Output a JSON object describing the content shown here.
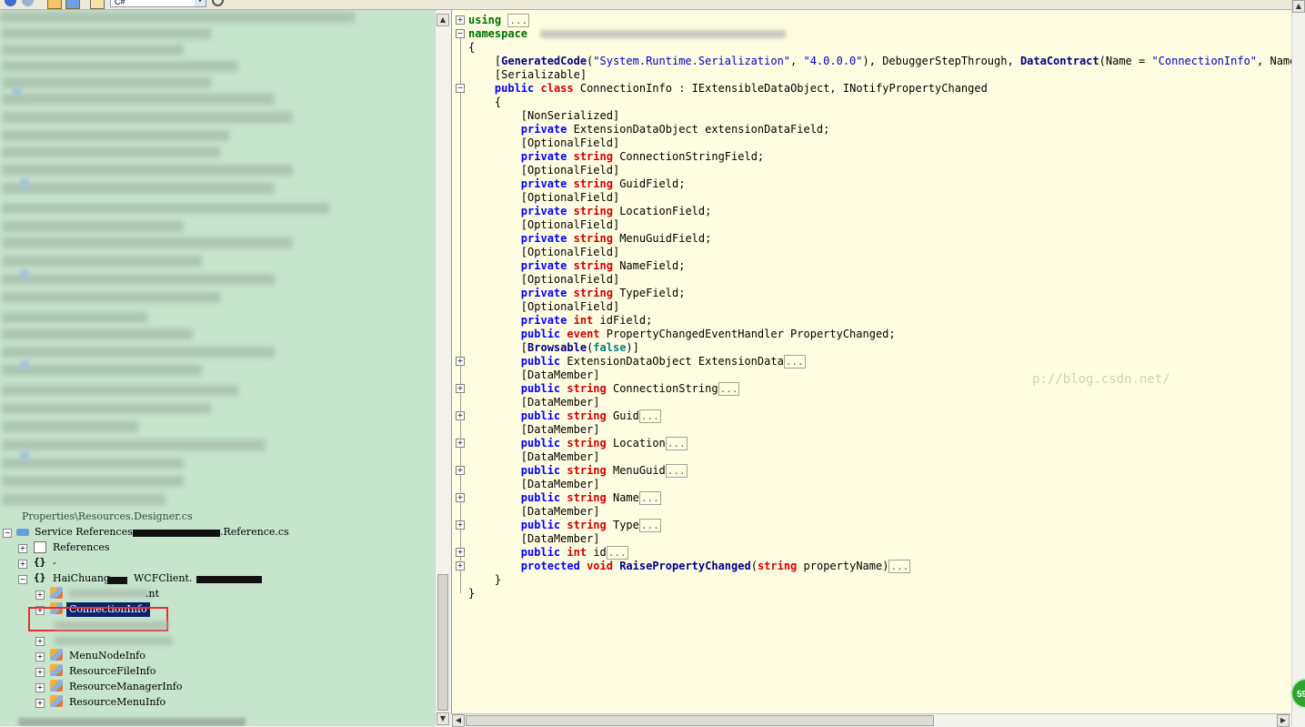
{
  "toolbar": {
    "language_selected": "C#"
  },
  "tree": {
    "items": [
      {
        "label": "Properties\\Resources.Designer.cs"
      },
      {
        "label": "Service References",
        "file_suffix": ".Reference.cs"
      },
      {
        "label": "References"
      },
      {
        "label": "-"
      },
      {
        "label": "HaiChuang.",
        "label_middle": "WCFClient."
      },
      {
        "label_suffix": ".nt"
      },
      {
        "label": "ConnectionInfo",
        "selected": true
      },
      {
        "label": "MenuNodeInfo"
      },
      {
        "label": "ResourceFileInfo"
      },
      {
        "label": "ResourceManagerInfo"
      },
      {
        "label": "ResourceMenuInfo"
      }
    ]
  },
  "code": {
    "using_kw": "using",
    "namespace_kw": "namespace",
    "collapsed": "...",
    "generated_attr": "GeneratedCode",
    "generated_arg1": "\"System.Runtime.Serialization\"",
    "generated_arg2": "\"4.0.0.0\"",
    "debugger_attr": "DebuggerStepThrough",
    "datacontract_attr": "DataContract",
    "name_arg": "\"ConnectionInfo\"",
    "namespace_arg": "Namespac",
    "serializable": "[Serializable]",
    "class_name": "ConnectionInfo",
    "interfaces": "IExtensibleDataObject, INotifyPropertyChanged",
    "nonserialized": "[NonSerialized]",
    "optionalfield": "[OptionalField]",
    "datamember": "[DataMember]",
    "event_handler": "PropertyChangedEventHandler PropertyChanged;",
    "browsable_attr": "Browsable",
    "browsable_arg": "false",
    "fields": [
      {
        "mod": "private",
        "type": "",
        "rest": "ExtensionDataObject extensionDataField;"
      },
      {
        "mod": "private",
        "type": "string",
        "rest": "ConnectionStringField;"
      },
      {
        "mod": "private",
        "type": "string",
        "rest": "GuidField;"
      },
      {
        "mod": "private",
        "type": "string",
        "rest": "LocationField;"
      },
      {
        "mod": "private",
        "type": "string",
        "rest": "MenuGuidField;"
      },
      {
        "mod": "private",
        "type": "string",
        "rest": "NameField;"
      },
      {
        "mod": "private",
        "type": "string",
        "rest": "TypeField;"
      },
      {
        "mod": "private",
        "type": "int",
        "rest": "idField;"
      }
    ],
    "props": [
      {
        "type": "",
        "name": "ExtensionDataObject ExtensionData"
      },
      {
        "type": "string",
        "name": "ConnectionString"
      },
      {
        "type": "string",
        "name": "Guid"
      },
      {
        "type": "string",
        "name": "Location"
      },
      {
        "type": "string",
        "name": "MenuGuid"
      },
      {
        "type": "string",
        "name": "Name"
      },
      {
        "type": "string",
        "name": "Type"
      },
      {
        "type": "int",
        "name": "id"
      }
    ],
    "raise_method": "RaisePropertyChanged",
    "raise_param": "string",
    "raise_param_name": "propertyName"
  },
  "watermark": "p://blog.csdn.net/",
  "badge": "59"
}
